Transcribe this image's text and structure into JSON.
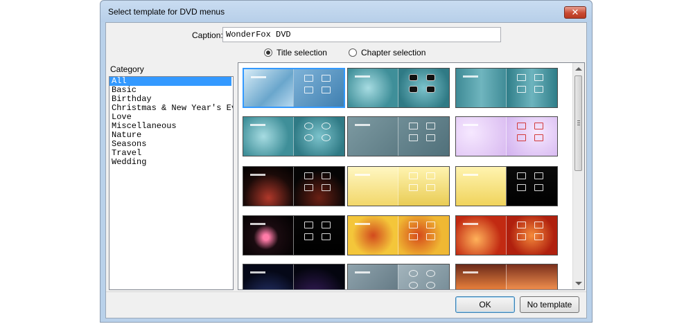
{
  "window": {
    "title": "Select template for DVD menus",
    "close_glyph": "✕"
  },
  "caption": {
    "label": "Caption:",
    "value": "WonderFox DVD"
  },
  "modes": [
    {
      "label": "Title selection",
      "checked": true
    },
    {
      "label": "Chapter selection",
      "checked": false
    }
  ],
  "category": {
    "label": "Category",
    "items": [
      "All",
      "Basic",
      "Birthday",
      "Christmas & New Year's Ev",
      "Love",
      "Miscellaneous",
      "Nature",
      "Seasons",
      "Travel",
      "Wedding"
    ],
    "selected": "All"
  },
  "templates": [
    {
      "theme": "blue-waves",
      "style": "squares",
      "selected": true
    },
    {
      "theme": "teal-frost",
      "style": "dark-rounded",
      "selected": false
    },
    {
      "theme": "teal-stripes",
      "style": "squares",
      "selected": false
    },
    {
      "theme": "teal-frost",
      "style": "ovals",
      "selected": false
    },
    {
      "theme": "grey-teal",
      "style": "squares",
      "selected": false
    },
    {
      "theme": "party-confetti",
      "style": "red-squares",
      "selected": false
    },
    {
      "theme": "birthday-cake",
      "style": "squares",
      "selected": false
    },
    {
      "theme": "christmas-tree",
      "style": "squares",
      "selected": false
    },
    {
      "theme": "christmas-tree-dark",
      "style": "squares",
      "selected": false
    },
    {
      "theme": "fireworks",
      "style": "squares",
      "selected": false
    },
    {
      "theme": "golden-heart",
      "style": "squares",
      "selected": false
    },
    {
      "theme": "red-heart",
      "style": "squares",
      "selected": false
    },
    {
      "theme": "dark-blue",
      "style": "none",
      "selected": false
    },
    {
      "theme": "grey-photo",
      "style": "ovals",
      "selected": false
    },
    {
      "theme": "sunset",
      "style": "none",
      "selected": false
    }
  ],
  "buttons": {
    "ok": "OK",
    "no_template": "No template"
  },
  "colors": {
    "selection": "#3399ff",
    "frame": "#b9d1ea"
  }
}
